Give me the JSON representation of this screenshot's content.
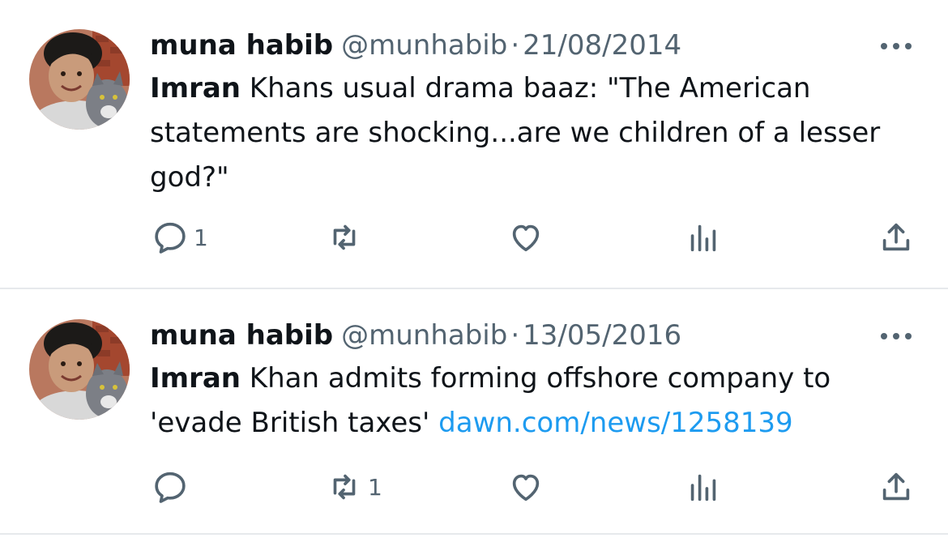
{
  "tweets": [
    {
      "display_name": "muna habib",
      "handle": "@munhabib",
      "separator": "·",
      "date": "21/08/2014",
      "text_lead": "Imran",
      "text_rest": " Khans usual drama baaz: \"The American statements are shocking...are we children of a lesser god?\"",
      "link": "",
      "reply_count": "1",
      "retweet_count": "",
      "like_count": "",
      "view_count": ""
    },
    {
      "display_name": "muna habib",
      "handle": "@munhabib",
      "separator": "·",
      "date": "13/05/2016",
      "text_lead": "Imran",
      "text_rest": " Khan admits forming offshore company to 'evade British taxes'  ",
      "link": "dawn.com/news/1258139",
      "reply_count": "",
      "retweet_count": "1",
      "like_count": "",
      "view_count": ""
    }
  ],
  "icons": {
    "reply": "reply-icon",
    "retweet": "retweet-icon",
    "like": "heart-icon",
    "views": "views-icon",
    "share": "share-icon",
    "more": "more-icon"
  },
  "colors": {
    "text": "#0f1419",
    "secondary": "#536471",
    "link": "#1d9bf0",
    "divider": "#e6e9ec"
  }
}
